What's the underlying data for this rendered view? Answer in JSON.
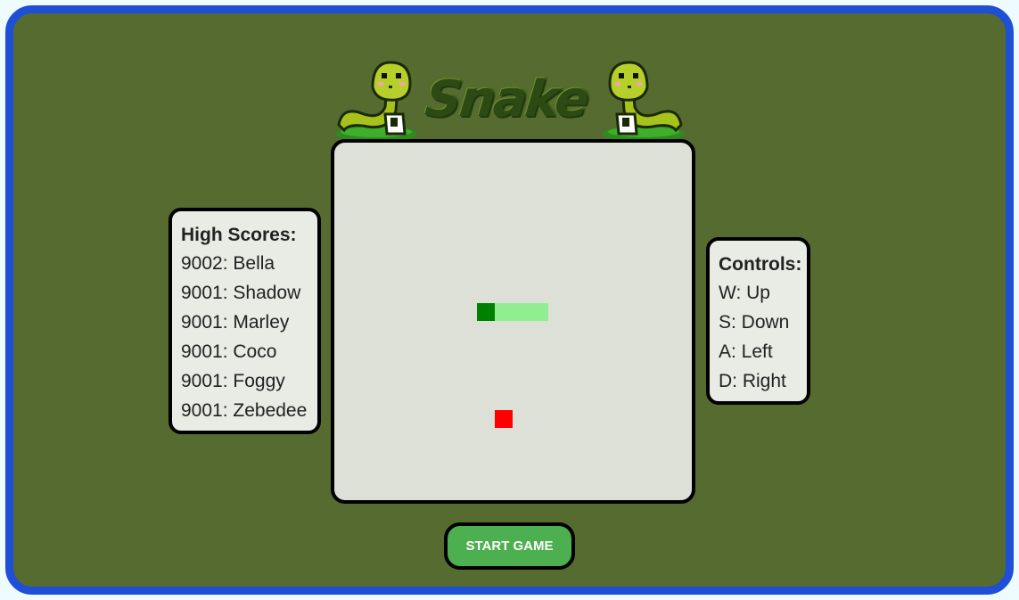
{
  "title": "Snake",
  "high_scores": {
    "title": "High Scores:",
    "entries": [
      {
        "score": "9002",
        "name": "Bella"
      },
      {
        "score": "9001",
        "name": "Shadow"
      },
      {
        "score": "9001",
        "name": "Marley"
      },
      {
        "score": "9001",
        "name": "Coco"
      },
      {
        "score": "9001",
        "name": "Foggy"
      },
      {
        "score": "9001",
        "name": "Zebedee"
      }
    ]
  },
  "controls": {
    "title": "Controls:",
    "items": [
      "W: Up",
      "S: Down",
      "A: Left",
      "D: Right"
    ]
  },
  "start_button_label": "START GAME",
  "game": {
    "grid_size": 20,
    "snake": [
      {
        "col": 8,
        "row": 9
      },
      {
        "col": 9,
        "row": 9
      },
      {
        "col": 10,
        "row": 9
      },
      {
        "col": 11,
        "row": 9
      }
    ],
    "food": {
      "col": 9,
      "row": 15
    },
    "colors": {
      "head": "#008000",
      "body": "#90ee90",
      "food": "#ff0000",
      "board": "#dce0d6"
    }
  },
  "colors": {
    "frame_border": "#1e4fd6",
    "background": "#556b2f",
    "button": "#4caf50"
  }
}
